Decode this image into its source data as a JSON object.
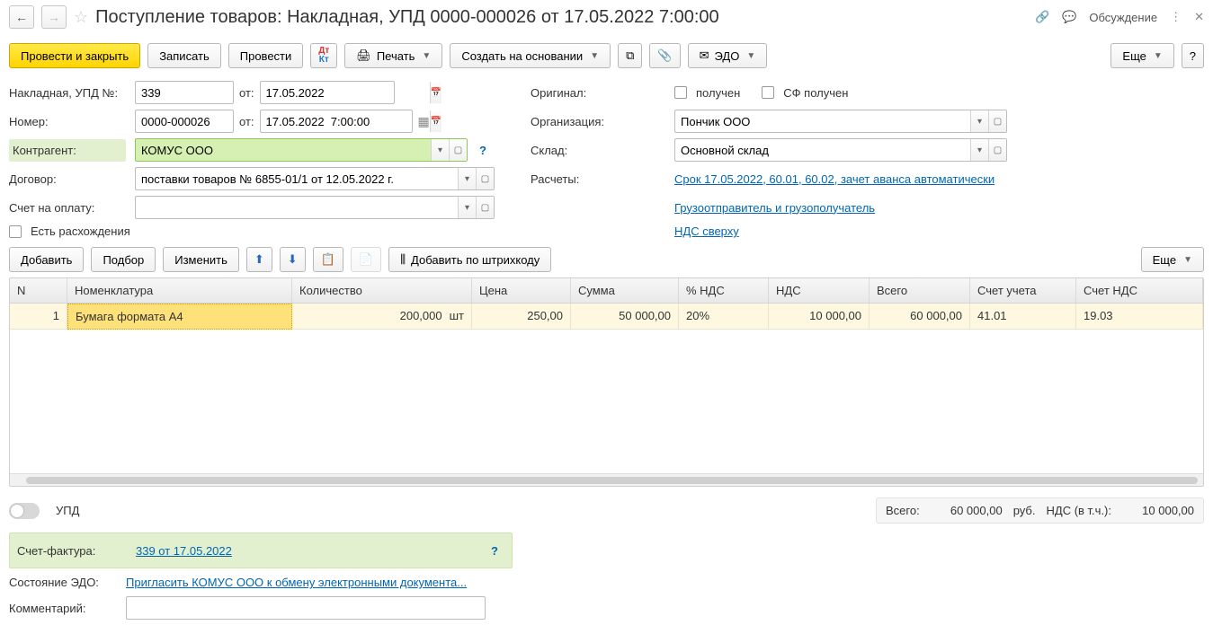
{
  "title": "Поступление товаров: Накладная, УПД 0000-000026 от 17.05.2022 7:00:00",
  "discussion_label": "Обсуждение",
  "toolbar": {
    "post_and_close": "Провести и закрыть",
    "save": "Записать",
    "post": "Провести",
    "print": "Печать",
    "create_based_on": "Создать на основании",
    "edo": "ЭДО",
    "more": "Еще"
  },
  "form": {
    "invoice_no_label": "Накладная, УПД №:",
    "invoice_no": "339",
    "from_label": "от:",
    "invoice_date": "17.05.2022",
    "number_label": "Номер:",
    "number": "0000-000026",
    "number_date": "17.05.2022  7:00:00",
    "counterparty_label": "Контрагент:",
    "counterparty": "КОМУС ООО",
    "contract_label": "Договор:",
    "contract": "поставки товаров № 6855-01/1 от 12.05.2022 г.",
    "bill_label": "Счет на оплату:",
    "bill": "",
    "discrepancies_label": "Есть расхождения",
    "original_label": "Оригинал:",
    "received_label": "получен",
    "sf_received_label": "СФ получен",
    "org_label": "Организация:",
    "org": "Пончик ООО",
    "warehouse_label": "Склад:",
    "warehouse": "Основной склад",
    "calc_label": "Расчеты:",
    "calc_link": "Срок 17.05.2022, 60.01, 60.02, зачет аванса автоматически",
    "shipper_link": "Грузоотправитель и грузополучатель",
    "vat_link": "НДС сверху"
  },
  "table_toolbar": {
    "add": "Добавить",
    "pick": "Подбор",
    "edit": "Изменить",
    "add_barcode": "Добавить по штрихкоду",
    "more": "Еще"
  },
  "table": {
    "headers": {
      "n": "N",
      "item": "Номенклатура",
      "qty": "Количество",
      "price": "Цена",
      "sum": "Сумма",
      "vat_pct": "% НДС",
      "vat": "НДС",
      "total": "Всего",
      "acct": "Счет учета",
      "vat_acct": "Счет НДС"
    },
    "rows": [
      {
        "n": "1",
        "item": "Бумага формата А4",
        "qty": "200,000",
        "unit": "шт",
        "price": "250,00",
        "sum": "50 000,00",
        "vat_pct": "20%",
        "vat": "10 000,00",
        "total": "60 000,00",
        "acct": "41.01",
        "vat_acct": "19.03"
      }
    ]
  },
  "footer": {
    "upd_label": "УПД",
    "total_label": "Всего:",
    "total_value": "60 000,00",
    "currency": "руб.",
    "vat_label": "НДС (в т.ч.):",
    "vat_value": "10 000,00"
  },
  "sf": {
    "label": "Счет-фактура:",
    "link": "339 от 17.05.2022"
  },
  "edo_state": {
    "label": "Состояние ЭДО:",
    "link": "Пригласить КОМУС ООО к обмену электронными документа..."
  },
  "comment_label": "Комментарий:",
  "comment_value": ""
}
